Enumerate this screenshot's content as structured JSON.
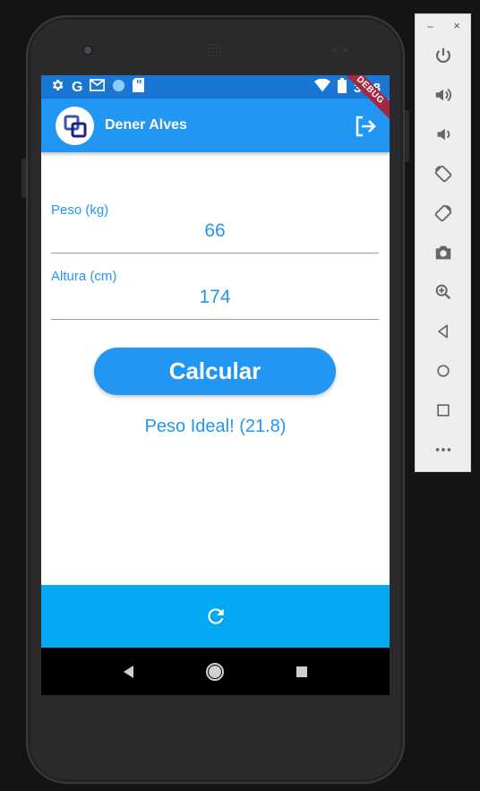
{
  "status_bar": {
    "time": "3:28",
    "icons": [
      "gear-icon",
      "google-g-icon",
      "gmail-icon",
      "circle-icon",
      "sd-card-icon",
      "wifi-icon",
      "battery-icon"
    ],
    "g_glyph": "G",
    "color": "#1976d2"
  },
  "app_bar": {
    "user_name": "Dener Alves",
    "color": "#2196f3",
    "debug_banner": "DEBUG"
  },
  "form": {
    "weight_label": "Peso (kg)",
    "weight_value": "66",
    "height_label": "Altura (cm)",
    "height_value": "174"
  },
  "calculate_label": "Calcular",
  "result_text": "Peso Ideal! (21.8)",
  "bottom_bar": {
    "icon": "refresh-icon",
    "color": "#03a9f4"
  },
  "nav_bar": {
    "icons": [
      "back-icon",
      "home-icon",
      "recents-icon"
    ]
  },
  "emulator_toolbar": {
    "minimize": "–",
    "close": "×",
    "buttons": [
      "power-icon",
      "volume-up-icon",
      "volume-down-icon",
      "rotate-left-icon",
      "rotate-right-icon",
      "camera-icon",
      "zoom-icon",
      "back-icon",
      "home-icon",
      "overview-icon",
      "more-icon"
    ]
  }
}
